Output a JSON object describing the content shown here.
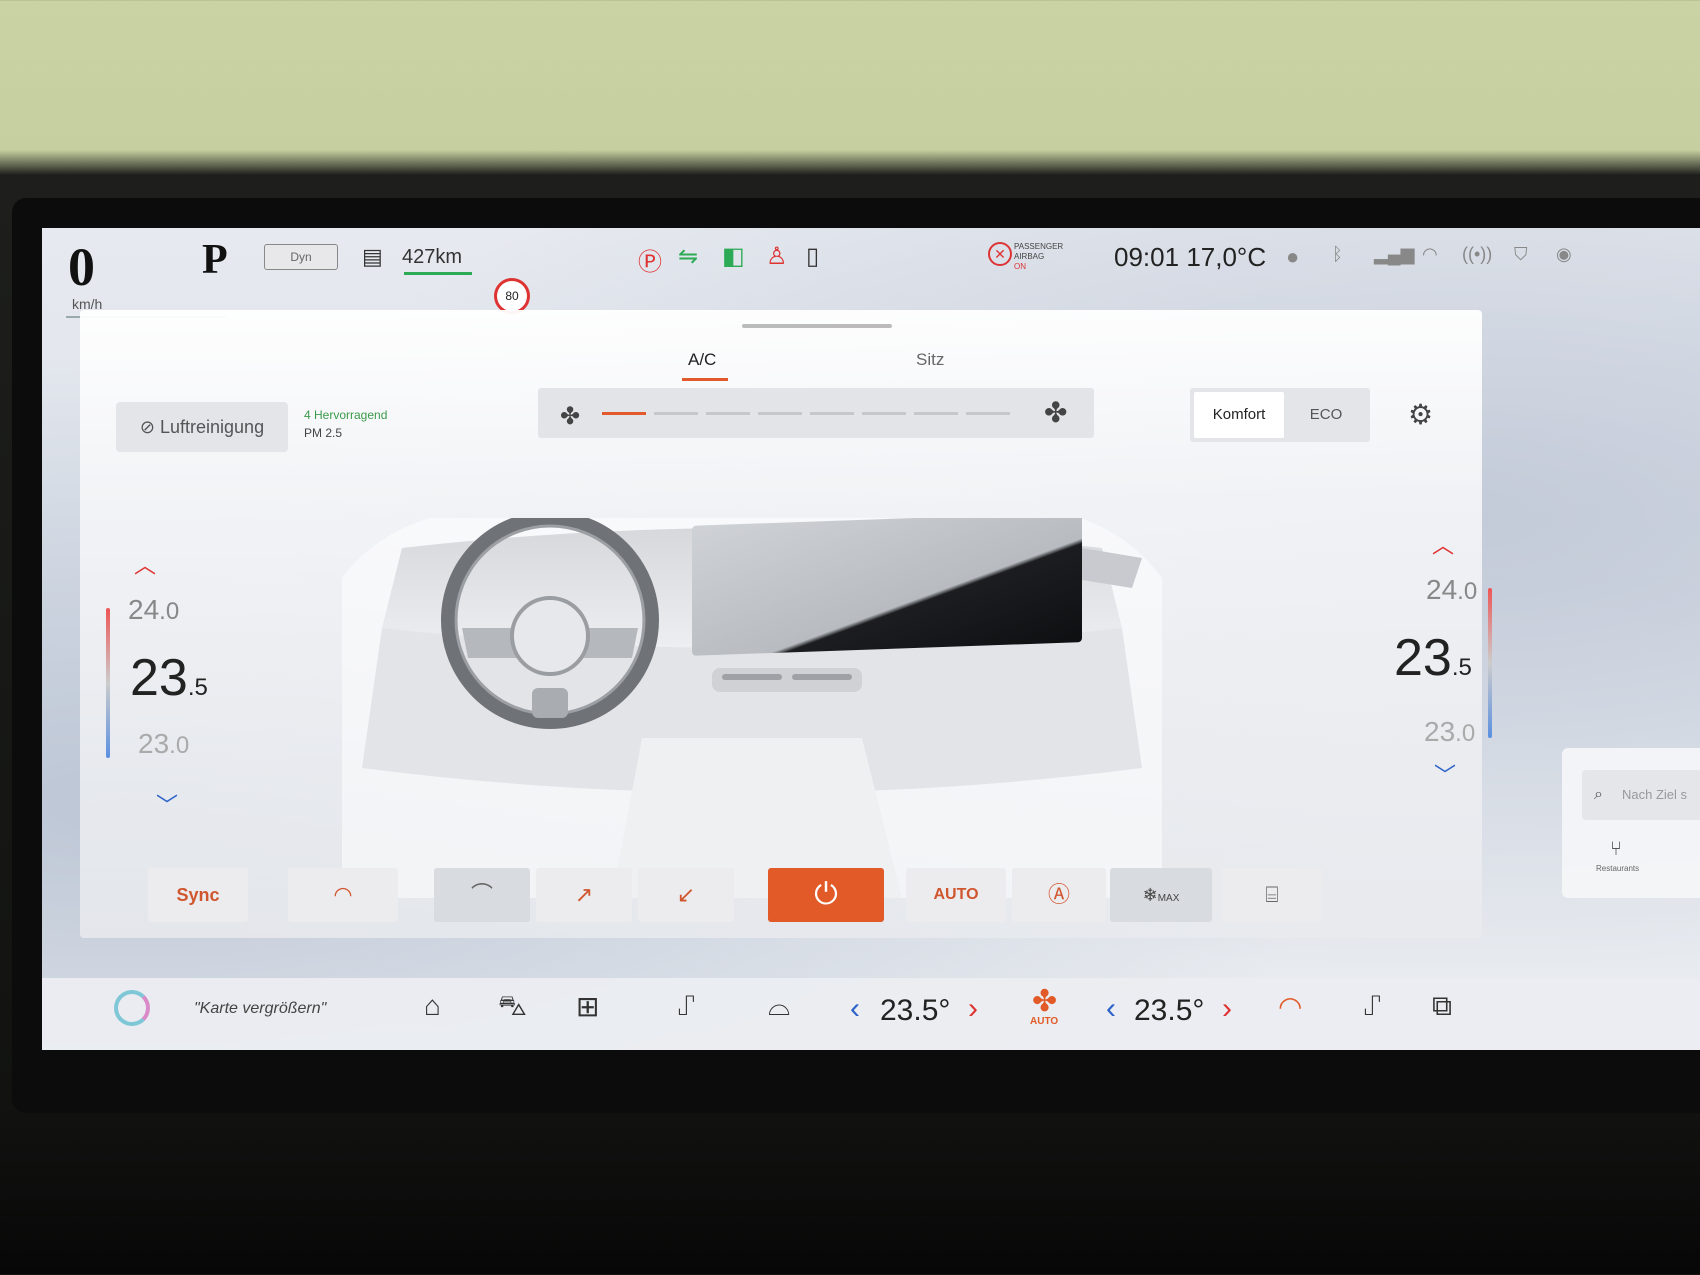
{
  "status_bar": {
    "speed": "0",
    "speed_unit": "km/h",
    "gear": "P",
    "drive_mode": "Dyn",
    "range": "427km",
    "speed_limit": "80",
    "passenger_airbag_label": "PASSENGER AIRBAG",
    "passenger_airbag_state": "ON",
    "time": "09:01",
    "outside_temp": "17,0°C",
    "icons": [
      "parking-brake-icon",
      "side-lights-icon",
      "low-beam-icon",
      "seatbelt-warning-icon",
      "door-open-icon",
      "user-profile-icon",
      "bluetooth-icon",
      "signal-icon",
      "wifi-icon",
      "connectivity-icon",
      "shield-icon",
      "privacy-icon"
    ]
  },
  "climate_panel": {
    "tabs": [
      {
        "label": "A/C"
      },
      {
        "label": "Sitz"
      }
    ],
    "active_tab": "A/C",
    "air_purification": {
      "label": "Luftreinigung",
      "quality": "4 Hervorragend",
      "pm_label": "PM 2.5"
    },
    "fan": {
      "level": 1,
      "max_level": 8
    },
    "modes": [
      {
        "label": "Komfort"
      },
      {
        "label": "ECO"
      }
    ],
    "active_mode": "Komfort",
    "driver_temp": {
      "above_main": "24",
      "above_dec": ".0",
      "main": "23",
      "main_dec": ".5",
      "below_main": "23",
      "below_dec": ".0"
    },
    "passenger_temp": {
      "above_main": "24",
      "above_dec": ".0",
      "main": "23",
      "main_dec": ".5",
      "below_main": "23",
      "below_dec": ".0"
    },
    "buttons": {
      "sync": "Sync",
      "auto": "AUTO",
      "max": "MAX"
    }
  },
  "nav_card": {
    "search_placeholder": "Nach Ziel s",
    "restaurants": "Restaurants"
  },
  "dock": {
    "voice_hint": "\"Karte vergrößern\"",
    "driver_temp": "23.5°",
    "passenger_temp": "23.5°",
    "fan_label": "AUTO"
  },
  "colors": {
    "accent": "#e15a28",
    "warm": "#dd3333",
    "cool": "#2c62c8",
    "good": "#3a9a4a"
  }
}
